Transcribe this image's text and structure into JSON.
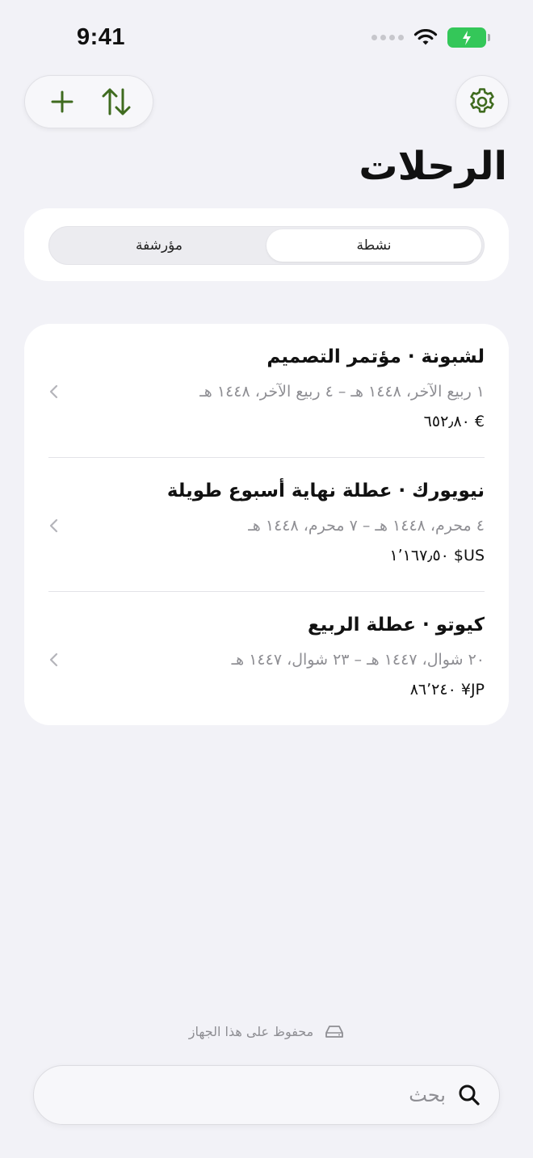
{
  "status_bar": {
    "time": "9:41"
  },
  "header": {
    "title": "الرحلات"
  },
  "segments": {
    "active": "نشطة",
    "archived": "مؤرشفة"
  },
  "trips": [
    {
      "title": "لشبونة · مؤتمر التصميم",
      "dates": "١ ربيع الآخر، ١٤٤٨ هـ – ٤ ربيع الآخر، ١٤٤٨ هـ",
      "amount": "€ ٦٥٢٫٨٠"
    },
    {
      "title": "نيويورك · عطلة نهاية أسبوع طويلة",
      "dates": "٤ محرم، ١٤٤٨ هـ – ٧ محرم، ١٤٤٨ هـ",
      "amount": "US$ ١٬١٦٧٫٥٠"
    },
    {
      "title": "كيوتو · عطلة الربيع",
      "dates": "٢٠ شوال، ١٤٤٧ هـ – ٢٣ شوال، ١٤٤٧ هـ",
      "amount": "JP¥ ٨٦٬٢٤٠"
    }
  ],
  "footer": {
    "saved_note": "محفوظ على هذا الجهاز"
  },
  "search": {
    "placeholder": "بحث"
  },
  "colors": {
    "accent": "#3f6b1f",
    "background": "#f2f2f7",
    "battery": "#34c759"
  },
  "icons": [
    "plus-icon",
    "sort-arrows-icon",
    "gear-icon",
    "chevron-left-icon",
    "drive-icon",
    "search-icon",
    "wifi-icon",
    "battery-charging-icon"
  ]
}
